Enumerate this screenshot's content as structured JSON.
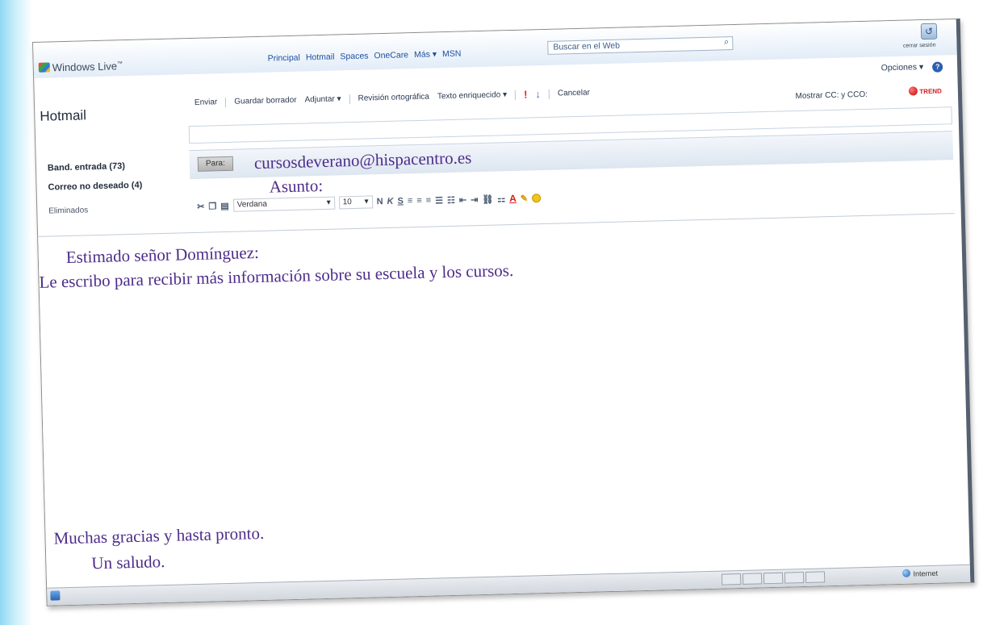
{
  "header": {
    "logo": "Windows Live",
    "logo_sup": "™",
    "nav": [
      "Principal",
      "Hotmail",
      "Spaces",
      "OneCare",
      "Más ▾",
      "MSN"
    ],
    "search_placeholder": "Buscar en el Web",
    "signout": "cerrar sesión",
    "options": "Opciones ▾",
    "help": "?"
  },
  "sidebar": {
    "title": "Hotmail",
    "items": [
      {
        "label": "Band. entrada (73)"
      },
      {
        "label": "Correo no deseado (4)"
      },
      {
        "label": "Eliminados"
      }
    ]
  },
  "toolbar": {
    "send": "Enviar",
    "save_draft": "Guardar borrador",
    "attach": "Adjuntar ▾",
    "spellcheck": "Revisión ortográfica",
    "rich_text": "Texto enriquecido ▾",
    "flag": "!",
    "low_priority": "↓",
    "cancel": "Cancelar",
    "show_cc": "Mostrar CC: y CCO:",
    "trend": "TREND"
  },
  "compose": {
    "to_button": "Para:",
    "to_value": "cursosdeverano@hispacentro.es",
    "subject_label": "Asunto:",
    "font": "Verdana",
    "font_size": "10",
    "format_icons": [
      "N",
      "K",
      "S"
    ]
  },
  "message": {
    "greeting": "Estimado señor Domínguez:",
    "body": "Le escribo para recibir más información sobre su escuela y los cursos.",
    "closing": "Muchas gracias y hasta pronto.",
    "signoff": "Un saludo."
  },
  "statusbar": {
    "zone": "Internet"
  }
}
